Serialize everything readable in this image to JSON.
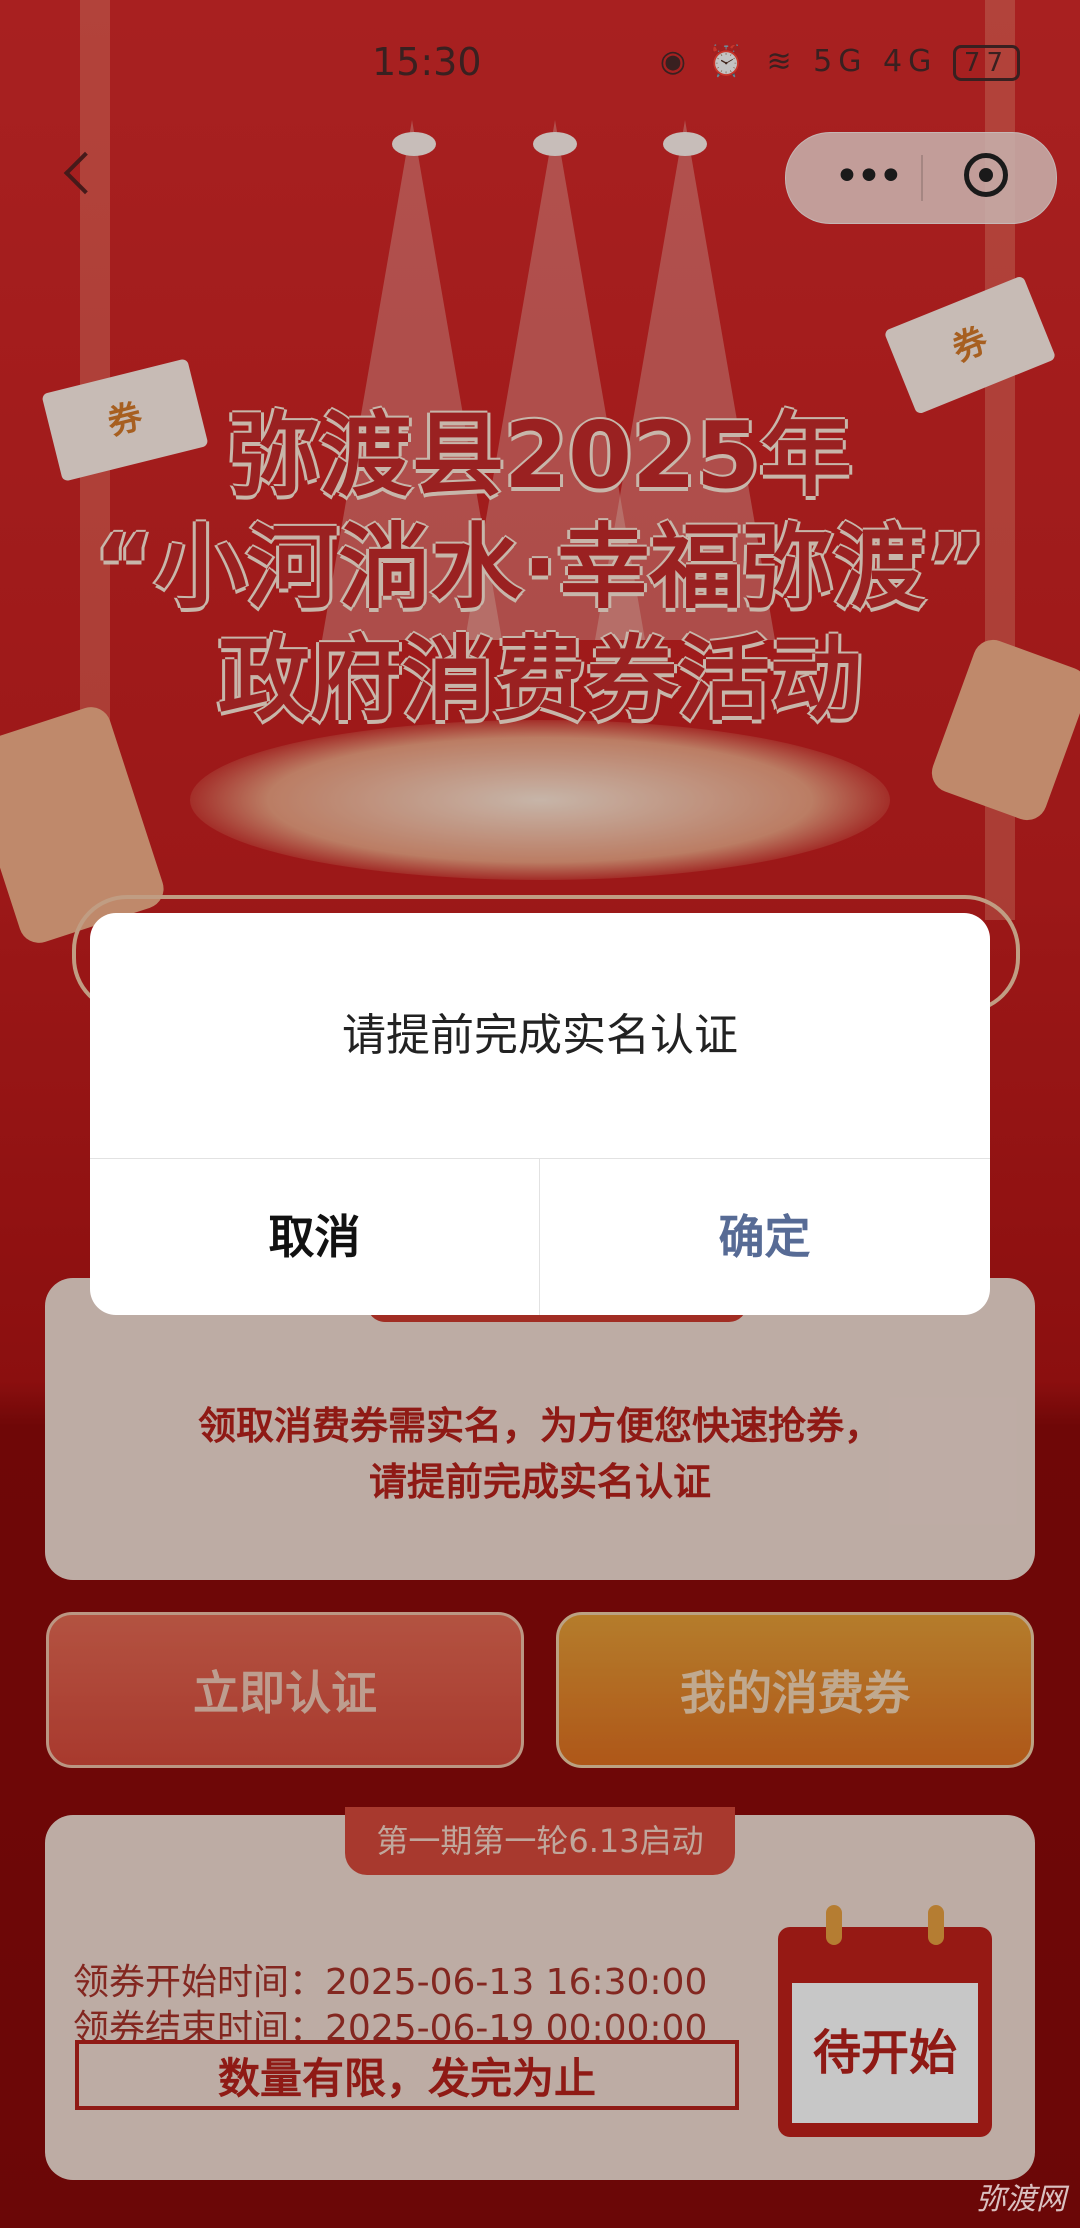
{
  "status_bar": {
    "time": "15:30",
    "signal": "5G 4G",
    "battery": "77"
  },
  "header": {
    "title_lines": [
      "弥渡县2025年",
      "“小河淌水·幸福弥渡”",
      "政府消费券活动"
    ],
    "ticket_label": "券"
  },
  "notice": {
    "text_line1": "领取消费券需实名，为方便您快速抢券，",
    "text_line2": "请提前完成实名认证"
  },
  "actions": {
    "verify_label": "立即认证",
    "my_coupons_label": "我的消费券"
  },
  "period": {
    "ribbon": "第一期第一轮6.13启动",
    "start_label": "领券开始时间：",
    "start_value": "2025-06-13 16:30:00",
    "end_label": "领券结束时间：",
    "end_value": "2025-06-19 00:00:00",
    "limit_text": "数量有限，发完为止",
    "status": "待开始"
  },
  "dialog": {
    "message": "请提前完成实名认证",
    "cancel_label": "取消",
    "confirm_label": "确定"
  },
  "watermark": "弥渡网",
  "colors": {
    "primary_red": "#c62b2b",
    "dialog_confirm": "#576b95"
  },
  "icons": [
    "back-arrow-icon",
    "more-dots-icon",
    "target-close-icon",
    "calendar-icon"
  ]
}
